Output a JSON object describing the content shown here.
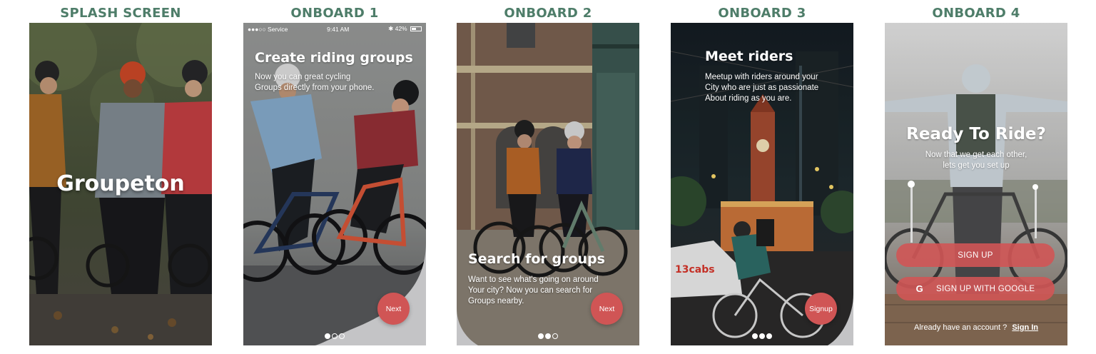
{
  "theme": {
    "title_color": "#4e7d69",
    "accent": "#d05555",
    "pager_panel": "#c4c4c6"
  },
  "columns": {
    "splash": {
      "title": "SPLASH SCREEN"
    },
    "onboard1": {
      "title": "ONBOARD 1"
    },
    "onboard2": {
      "title": "ONBOARD 2"
    },
    "onboard3": {
      "title": "ONBOARD 3"
    },
    "onboard4": {
      "title": "ONBOARD 4"
    }
  },
  "splash": {
    "app_name": "Groupeton"
  },
  "onboard1": {
    "status": {
      "carrier": "●●●○○ Service",
      "time": "9:41 AM",
      "battery": "42%"
    },
    "heading": "Create riding groups",
    "body_lines": [
      "Now you can great cycling",
      "Groups directly from your phone."
    ],
    "button": "Next",
    "page_index": 0,
    "page_count": 3
  },
  "onboard2": {
    "heading": "Search for groups",
    "body_lines": [
      "Want to see what's going on around",
      "Your city? Now you can search for",
      "Groups nearby."
    ],
    "button": "Next",
    "page_index": 1,
    "page_count": 3
  },
  "onboard3": {
    "heading": "Meet riders",
    "body_lines": [
      "Meetup with riders around your",
      "City who are just as passionate",
      "About riding as you are."
    ],
    "taxi_sign": "13cabs",
    "button": "Signup",
    "page_index": 2,
    "page_count": 3
  },
  "onboard4": {
    "heading": "Ready To Ride?",
    "body_lines": [
      "Now that we get each other,",
      "lets get you set up"
    ],
    "signup_button": "SIGN UP",
    "google_glyph": "G",
    "google_button": "SIGN UP WITH GOOGLE",
    "account_prompt": "Already have an account ?",
    "signin_link": "Sign In"
  }
}
